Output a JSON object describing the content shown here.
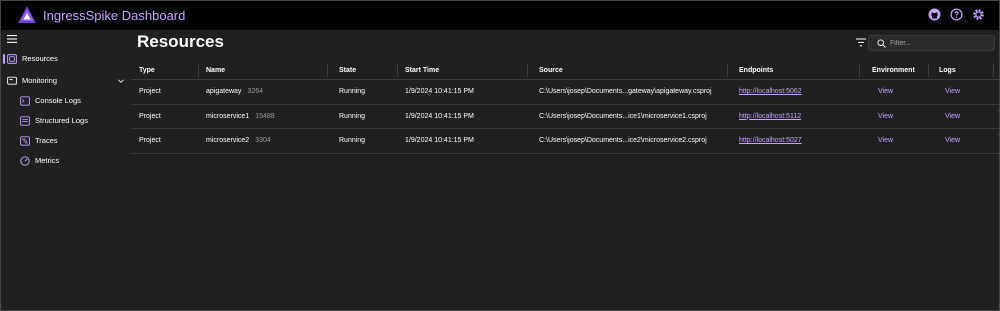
{
  "app": {
    "title": "IngressSpike Dashboard"
  },
  "topbar": {
    "icons": [
      "github-icon",
      "help-icon",
      "settings-icon"
    ]
  },
  "sidebar": {
    "items": [
      {
        "label": "Resources",
        "icon": "resources-icon",
        "active": true
      },
      {
        "label": "Monitoring",
        "icon": "monitoring-icon",
        "expanded": true
      },
      {
        "label": "Console Logs",
        "icon": "console-logs-icon"
      },
      {
        "label": "Structured Logs",
        "icon": "structured-logs-icon"
      },
      {
        "label": "Traces",
        "icon": "traces-icon"
      },
      {
        "label": "Metrics",
        "icon": "metrics-icon"
      }
    ]
  },
  "main": {
    "title": "Resources",
    "filter": {
      "placeholder": "Filter..."
    }
  },
  "table": {
    "headers": [
      "Type",
      "Name",
      "State",
      "Start Time",
      "Source",
      "Endpoints",
      "Environment",
      "Logs"
    ],
    "rows": [
      {
        "type": "Project",
        "name": "apigateway",
        "pid": "3264",
        "state": "Running",
        "start": "1/9/2024 10:41:15 PM",
        "source": "C:\\Users\\josep\\Documents...gateway\\apigateway.csproj",
        "endpoint": "http://localhost:5062",
        "environment": "View",
        "logs": "View"
      },
      {
        "type": "Project",
        "name": "microservice1",
        "pid": "15488",
        "state": "Running",
        "start": "1/9/2024 10:41:15 PM",
        "source": "C:\\Users\\josep\\Documents...ice1\\microservice1.csproj",
        "endpoint": "http://localhost:5112",
        "environment": "View",
        "logs": "View"
      },
      {
        "type": "Project",
        "name": "microservice2",
        "pid": "3304",
        "state": "Running",
        "start": "1/9/2024 10:41:15 PM",
        "source": "C:\\Users\\josep\\Documents...ice2\\microservice2.csproj",
        "endpoint": "http://localhost:5027",
        "environment": "View",
        "logs": "View"
      }
    ]
  },
  "colors": {
    "accent": "#c4a4ff",
    "background": "#202020",
    "topbar": "#000000"
  }
}
